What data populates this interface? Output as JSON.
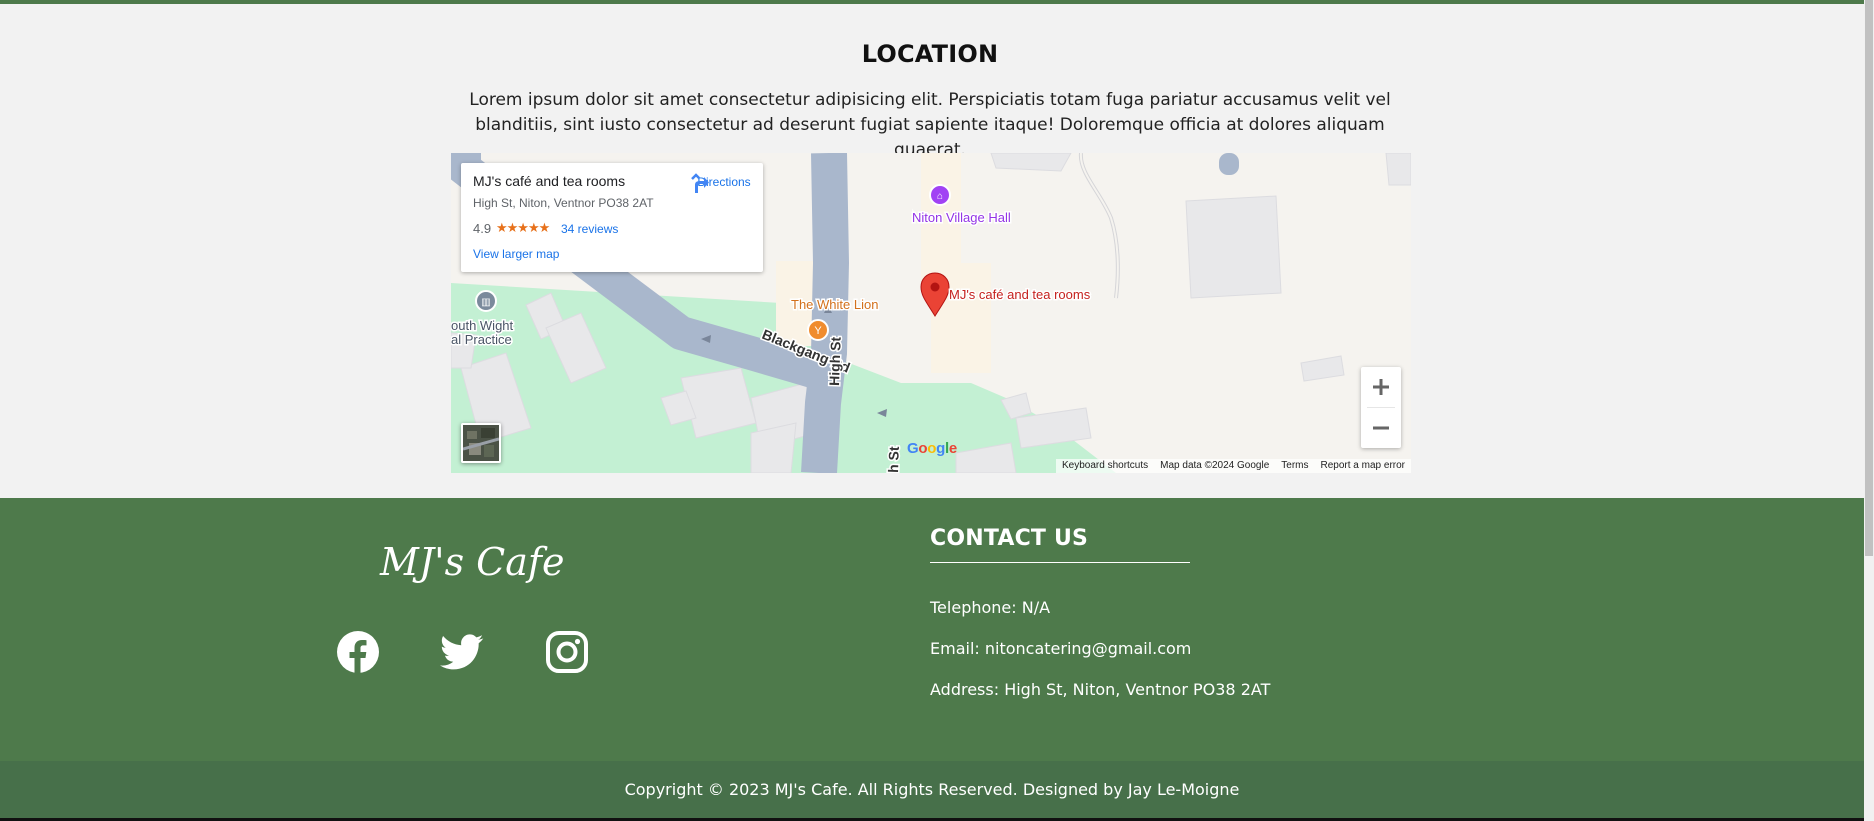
{
  "location": {
    "title": "LOCATION",
    "text": "Lorem ipsum dolor sit amet consectetur adipisicing elit. Perspiciatis totam fuga pariatur accusamus velit vel blanditiis, sint iusto consectetur ad deserunt fugiat sapiente itaque! Doloremque officia at dolores aliquam quaerat."
  },
  "map": {
    "place_name": "MJ's café and tea rooms",
    "address": "High St, Niton, Ventnor PO38 2AT",
    "rating": "4.9",
    "stars": "★★★★★",
    "reviews_link": "34 reviews",
    "larger_map_link": "View larger map",
    "directions_label": "Directions",
    "labels": {
      "village_hall": "Niton Village Hall",
      "pin_label": "MJ's café and tea rooms",
      "white_lion": "The White Lion",
      "practice_line1": "outh Wight",
      "practice_line2": "al Practice",
      "road_blackgang": "Blackgang Rd",
      "road_high_st": "High St",
      "road_high_st_lower": "h St"
    },
    "zoom_in": "+",
    "zoom_out": "−",
    "google_logo": "Google",
    "footer_links": [
      "Keyboard shortcuts",
      "Map data ©2024 Google",
      "Terms",
      "Report a map error"
    ],
    "colors": {
      "road": "#a9b7cc",
      "park": "#c3f0d3",
      "pin": "#ea4335",
      "building": "#e8e8ea"
    }
  },
  "footer": {
    "brand": "MJ's Cafe",
    "social": [
      "facebook-icon",
      "twitter-icon",
      "instagram-icon"
    ],
    "contact_title": "CONTACT US",
    "telephone": "Telephone: N/A",
    "email": "Email: nitoncatering@gmail.com",
    "address": "Address: High St, Niton, Ventnor PO38 2AT",
    "copyright": "Copyright © 2023 MJ's Cafe. All Rights Reserved. Designed by Jay Le-Moigne",
    "bg_color": "#4e7a4b"
  }
}
